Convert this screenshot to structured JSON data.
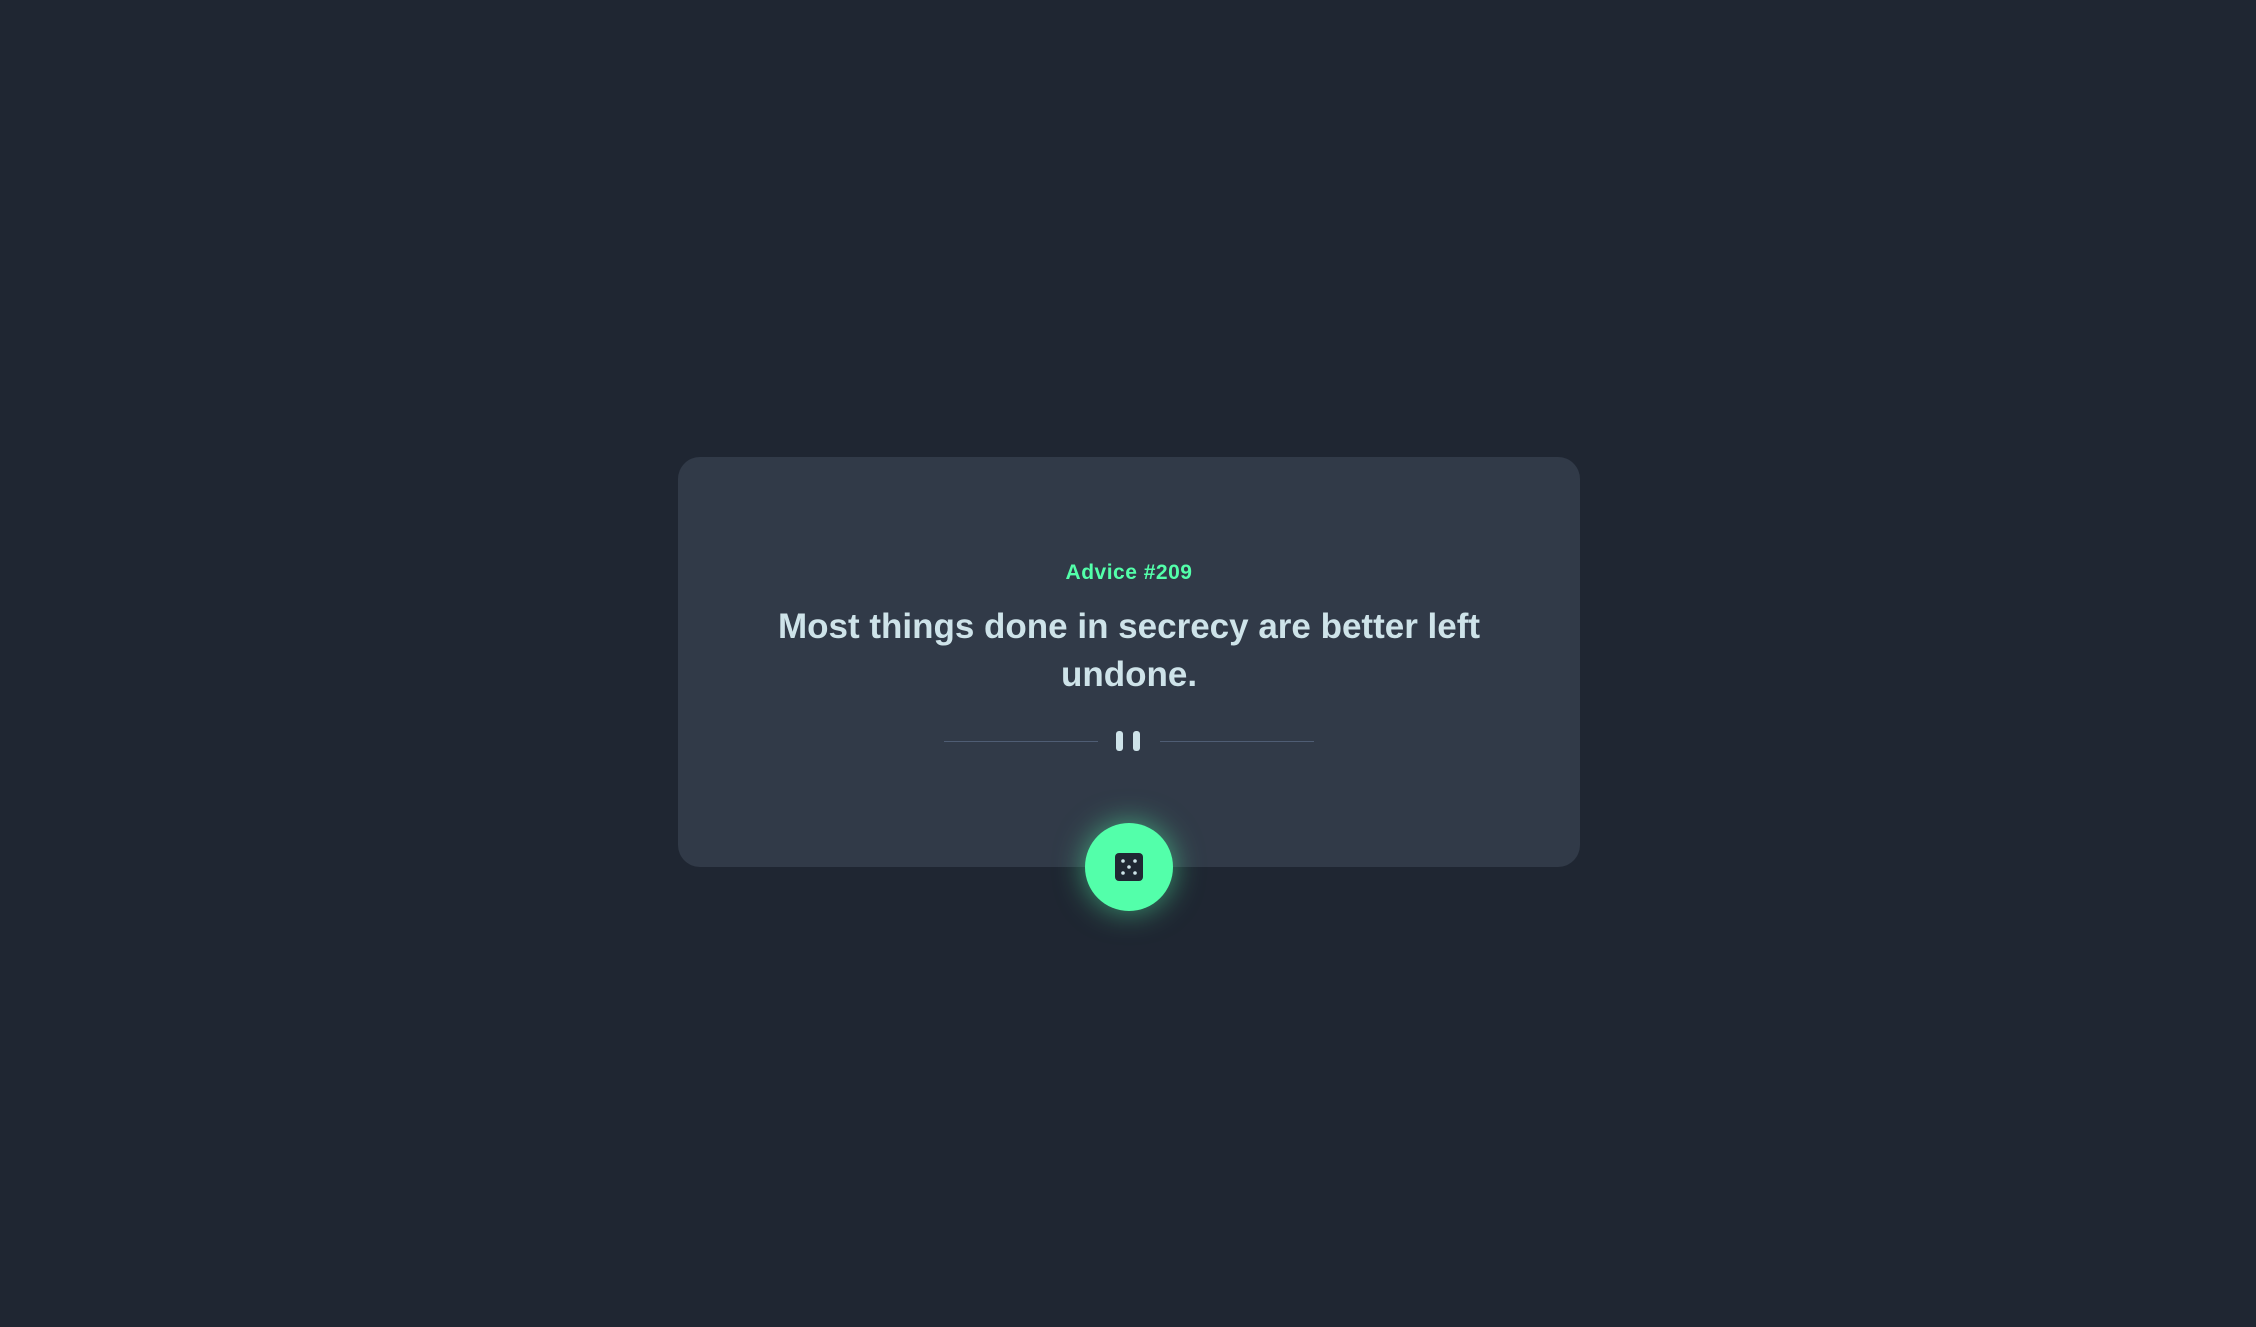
{
  "advice": {
    "id_label": "Advice #209",
    "text": "Most things done in secrecy are better left undone."
  },
  "icons": {
    "divider": "pause-icon",
    "button": "dice-icon"
  },
  "colors": {
    "background": "#1f2632",
    "card": "#313a48",
    "accent": "#53ffaa",
    "text": "#cee3e9",
    "divider": "#4f5d74"
  }
}
